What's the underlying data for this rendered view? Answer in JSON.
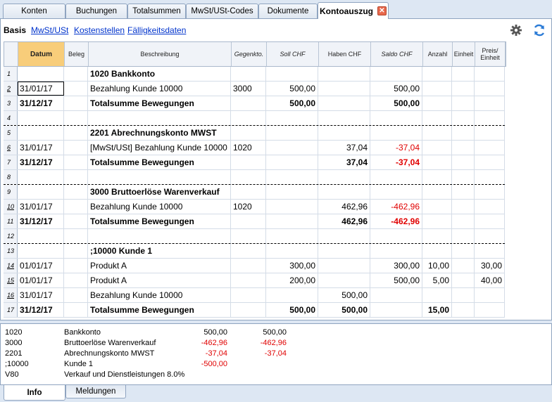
{
  "tabs": [
    {
      "label": "Konten",
      "active": false
    },
    {
      "label": "Buchungen",
      "active": false
    },
    {
      "label": "Totalsummen",
      "active": false
    },
    {
      "label": "MwSt/USt-Codes",
      "active": false
    },
    {
      "label": "Dokumente",
      "active": false
    },
    {
      "label": "Kontoauszug",
      "active": true
    }
  ],
  "close_glyph": "✕",
  "subtabs": [
    {
      "label": "Basis",
      "active": true
    },
    {
      "label": "MwSt/USt",
      "active": false
    },
    {
      "label": "Kostenstellen",
      "active": false
    },
    {
      "label": "Fälligkeitsdaten",
      "active": false
    }
  ],
  "toolbar": {
    "settings_icon": "gear-icon",
    "refresh_icon": "refresh-icon"
  },
  "columns": [
    "",
    "Datum",
    "Beleg",
    "Beschreibung",
    "Gegenkto.",
    "Soll CHF",
    "Haben CHF",
    "Saldo CHF",
    "Anzahl",
    "Einheit",
    "Preis/ Einheit"
  ],
  "rows": [
    {
      "n": "1",
      "date": "",
      "doc": "",
      "desc": "1020 Bankkonto",
      "contra": "",
      "debit": "",
      "credit": "",
      "balance": "",
      "qty": "",
      "unit": "",
      "price": ""
    },
    {
      "n": "2",
      "date": "31/01/17",
      "doc": "",
      "desc": "Bezahlung Kunde 10000",
      "contra": "3000",
      "debit": "500,00",
      "credit": "",
      "balance": "500,00",
      "qty": "",
      "unit": "",
      "price": ""
    },
    {
      "n": "3",
      "date": "31/12/17",
      "doc": "",
      "desc": "Totalsumme Bewegungen",
      "contra": "",
      "debit": "500,00",
      "credit": "",
      "balance": "500,00",
      "qty": "",
      "unit": "",
      "price": ""
    },
    {
      "n": "4",
      "date": "",
      "doc": "",
      "desc": "",
      "contra": "",
      "debit": "",
      "credit": "",
      "balance": "",
      "qty": "",
      "unit": "",
      "price": ""
    },
    {
      "n": "5",
      "date": "",
      "doc": "",
      "desc": "2201 Abrechnungskonto MWST",
      "contra": "",
      "debit": "",
      "credit": "",
      "balance": "",
      "qty": "",
      "unit": "",
      "price": ""
    },
    {
      "n": "6",
      "date": "31/01/17",
      "doc": "",
      "desc": "[MwSt/USt] Bezahlung Kunde 10000",
      "contra": "1020",
      "debit": "",
      "credit": "37,04",
      "balance": "-37,04",
      "qty": "",
      "unit": "",
      "price": ""
    },
    {
      "n": "7",
      "date": "31/12/17",
      "doc": "",
      "desc": "Totalsumme Bewegungen",
      "contra": "",
      "debit": "",
      "credit": "37,04",
      "balance": "-37,04",
      "qty": "",
      "unit": "",
      "price": ""
    },
    {
      "n": "8",
      "date": "",
      "doc": "",
      "desc": "",
      "contra": "",
      "debit": "",
      "credit": "",
      "balance": "",
      "qty": "",
      "unit": "",
      "price": ""
    },
    {
      "n": "9",
      "date": "",
      "doc": "",
      "desc": "3000 Bruttoerlöse Warenverkauf",
      "contra": "",
      "debit": "",
      "credit": "",
      "balance": "",
      "qty": "",
      "unit": "",
      "price": ""
    },
    {
      "n": "10",
      "date": "31/01/17",
      "doc": "",
      "desc": "Bezahlung Kunde 10000",
      "contra": "1020",
      "debit": "",
      "credit": "462,96",
      "balance": "-462,96",
      "qty": "",
      "unit": "",
      "price": ""
    },
    {
      "n": "11",
      "date": "31/12/17",
      "doc": "",
      "desc": "Totalsumme Bewegungen",
      "contra": "",
      "debit": "",
      "credit": "462,96",
      "balance": "-462,96",
      "qty": "",
      "unit": "",
      "price": ""
    },
    {
      "n": "12",
      "date": "",
      "doc": "",
      "desc": "",
      "contra": "",
      "debit": "",
      "credit": "",
      "balance": "",
      "qty": "",
      "unit": "",
      "price": ""
    },
    {
      "n": "13",
      "date": "",
      "doc": "",
      "desc": ";10000 Kunde 1",
      "contra": "",
      "debit": "",
      "credit": "",
      "balance": "",
      "qty": "",
      "unit": "",
      "price": ""
    },
    {
      "n": "14",
      "date": "01/01/17",
      "doc": "",
      "desc": "Produkt A",
      "contra": "",
      "debit": "300,00",
      "credit": "",
      "balance": "300,00",
      "qty": "10,00",
      "unit": "",
      "price": "30,00"
    },
    {
      "n": "15",
      "date": "01/01/17",
      "doc": "",
      "desc": "Produkt A",
      "contra": "",
      "debit": "200,00",
      "credit": "",
      "balance": "500,00",
      "qty": "5,00",
      "unit": "",
      "price": "40,00"
    },
    {
      "n": "16",
      "date": "31/01/17",
      "doc": "",
      "desc": "Bezahlung Kunde 10000",
      "contra": "",
      "debit": "",
      "credit": "500,00",
      "balance": "",
      "qty": "",
      "unit": "",
      "price": ""
    },
    {
      "n": "17",
      "date": "31/12/17",
      "doc": "",
      "desc": "Totalsumme Bewegungen",
      "contra": "",
      "debit": "500,00",
      "credit": "500,00",
      "balance": "",
      "qty": "15,00",
      "unit": "",
      "price": ""
    }
  ],
  "info": [
    {
      "code": "1020",
      "name": "Bankkonto",
      "v1": "500,00",
      "v2": "500,00"
    },
    {
      "code": "3000",
      "name": "Bruttoerlöse Warenverkauf",
      "v1": "-462,96",
      "v2": "-462,96"
    },
    {
      "code": "2201",
      "name": "Abrechnungskonto MWST",
      "v1": "-37,04",
      "v2": "-37,04"
    },
    {
      "code": ";10000",
      "name": "Kunde 1",
      "v1": "-500,00",
      "v2": ""
    },
    {
      "code": "V80",
      "name": "Verkauf und Dienstleistungen 8.0%",
      "v1": "",
      "v2": ""
    }
  ],
  "bottom_tabs": [
    {
      "label": "Info",
      "active": true
    },
    {
      "label": "Meldungen",
      "active": false
    }
  ],
  "colors": {
    "accent_header": "#f8cd7a",
    "negative": "#e00000",
    "link": "#0033cc"
  }
}
